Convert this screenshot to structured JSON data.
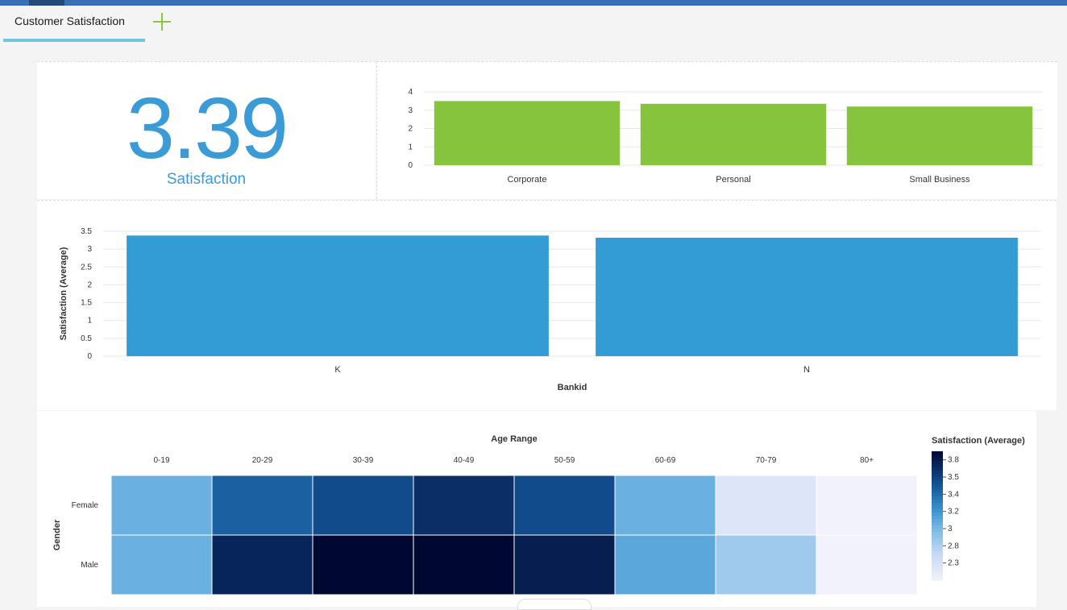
{
  "tabs": [
    {
      "label": "Customer Satisfaction"
    }
  ],
  "kpi": {
    "value": "3.39",
    "label": "Satisfaction"
  },
  "segment_chart": {
    "chart_data": {
      "type": "bar",
      "categories": [
        "Corporate",
        "Personal",
        "Small Business"
      ],
      "values": [
        3.5,
        3.35,
        3.2
      ],
      "ylim": [
        0,
        4
      ],
      "yticks": [
        "0",
        "1",
        "2",
        "3",
        "4"
      ],
      "color": "#86c43e",
      "grid": true
    }
  },
  "bank_chart": {
    "chart_data": {
      "type": "bar",
      "categories": [
        "K",
        "N"
      ],
      "values": [
        3.38,
        3.32
      ],
      "ylim": [
        0,
        3.5
      ],
      "yticks": [
        "0",
        "0.5",
        "1",
        "1.5",
        "2",
        "2.5",
        "3",
        "3.5"
      ],
      "xlabel": "Bankid",
      "ylabel": "Satisfaction (Average)",
      "color": "#339cd5",
      "grid": true
    }
  },
  "heatmap": {
    "chart_data": {
      "type": "heatmap",
      "x_title": "Age Range",
      "y_title": "Gender",
      "x": [
        "0-19",
        "20-29",
        "30-39",
        "40-49",
        "50-59",
        "60-69",
        "70-79",
        "80+"
      ],
      "y": [
        "Female",
        "Male"
      ],
      "values": [
        [
          3.05,
          3.45,
          3.55,
          3.7,
          3.55,
          3.05,
          2.55,
          2.25
        ],
        [
          3.05,
          3.75,
          3.95,
          3.92,
          3.78,
          3.1,
          2.85,
          2.2
        ]
      ],
      "legend_title": "Satisfaction (Average)",
      "legend_ticks": [
        "3.8",
        "3.5",
        "3.4",
        "3.2",
        "3",
        "2.8",
        "2.3"
      ],
      "legend_tick_values": [
        3.8,
        3.6,
        3.4,
        3.2,
        3.0,
        2.8,
        2.6
      ],
      "range": [
        2.4,
        3.9
      ],
      "legend_placement": "right"
    }
  },
  "colors": {
    "accent": "#3a9bd7",
    "tab_underline": "#6ec6e0",
    "add_icon": "#8cc63f",
    "header_bar": "#3b70b8"
  }
}
